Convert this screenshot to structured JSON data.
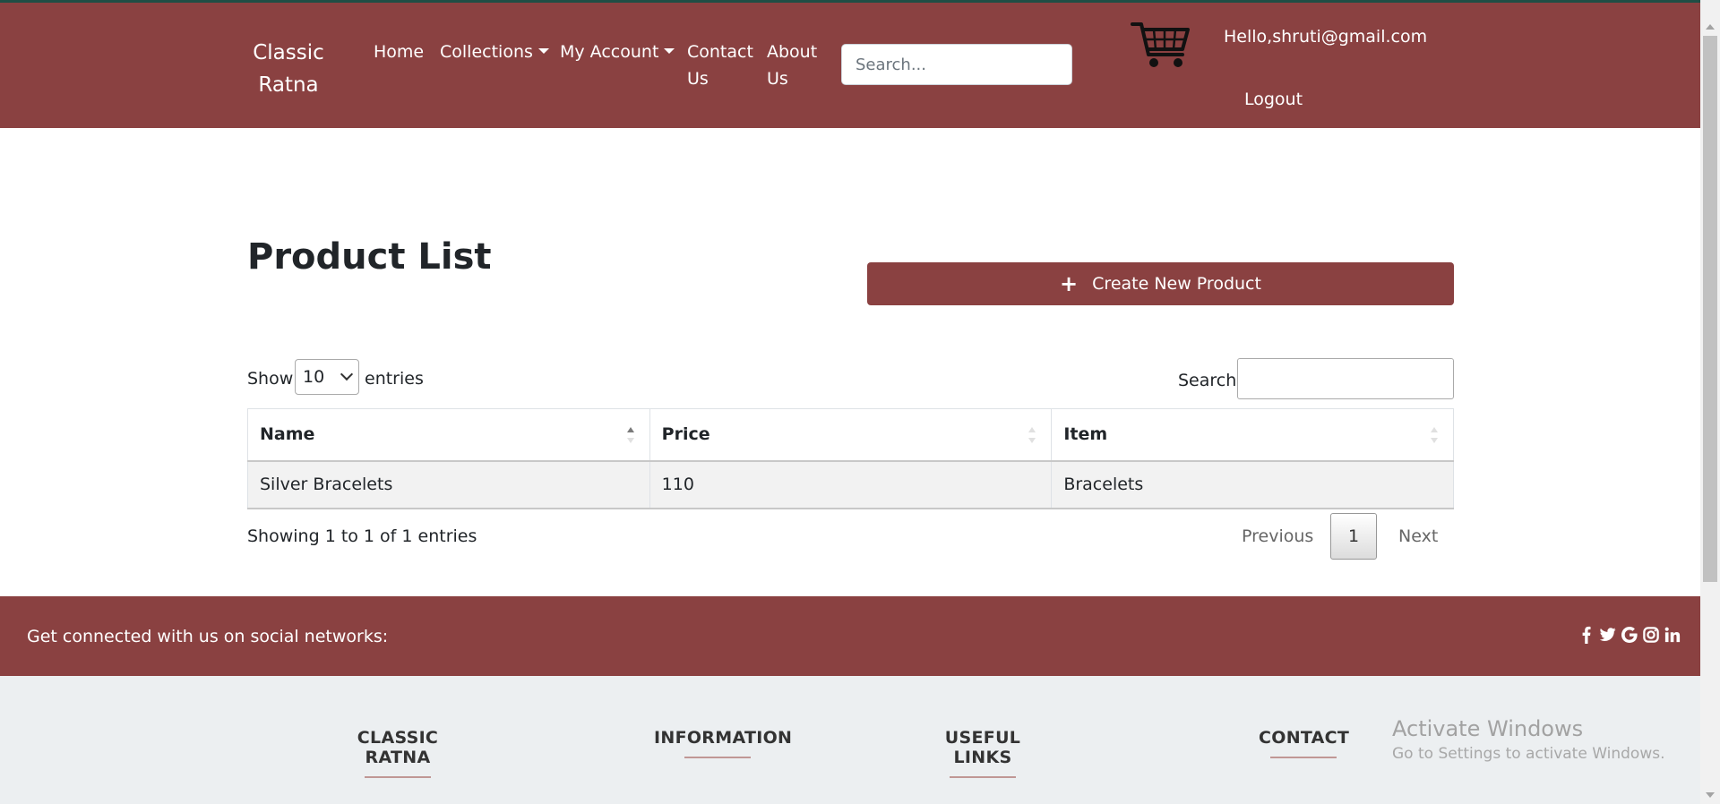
{
  "nav": {
    "brand": "Classic Ratna",
    "home": "Home",
    "collections": "Collections",
    "my_account": "My Account",
    "contact": "Contact Us",
    "about": "About Us",
    "search_placeholder": "Search...",
    "greeting": "Hello,shruti@gmail.com",
    "logout": "Logout",
    "cart_icon": "shopping-cart-icon"
  },
  "main": {
    "title": "Product List",
    "create_button": "Create New Product",
    "create_icon": "plus-icon"
  },
  "table_controls": {
    "show_label": "Show",
    "entries_value": "10",
    "entries_label": "entries",
    "search_label": "Search:",
    "search_value": ""
  },
  "table": {
    "columns": [
      "Name",
      "Price",
      "Item"
    ],
    "rows": [
      [
        "Silver Bracelets",
        "110",
        "Bracelets"
      ]
    ]
  },
  "pagination": {
    "info": "Showing 1 to 1 of 1 entries",
    "previous": "Previous",
    "current_page": "1",
    "next": "Next"
  },
  "social": {
    "text": "Get connected with us on social networks:",
    "icons": [
      "facebook-icon",
      "twitter-icon",
      "google-icon",
      "instagram-icon",
      "linkedin-icon"
    ]
  },
  "footer": {
    "headings": [
      "CLASSIC RATNA",
      "INFORMATION",
      "USEFUL LINKS",
      "CONTACT"
    ]
  },
  "watermark": {
    "title": "Activate Windows",
    "subtitle": "Go to Settings to activate Windows."
  },
  "colors": {
    "brand": "#8a4141",
    "footer_bg": "#eceff1",
    "heading_underline": "#c09795"
  }
}
